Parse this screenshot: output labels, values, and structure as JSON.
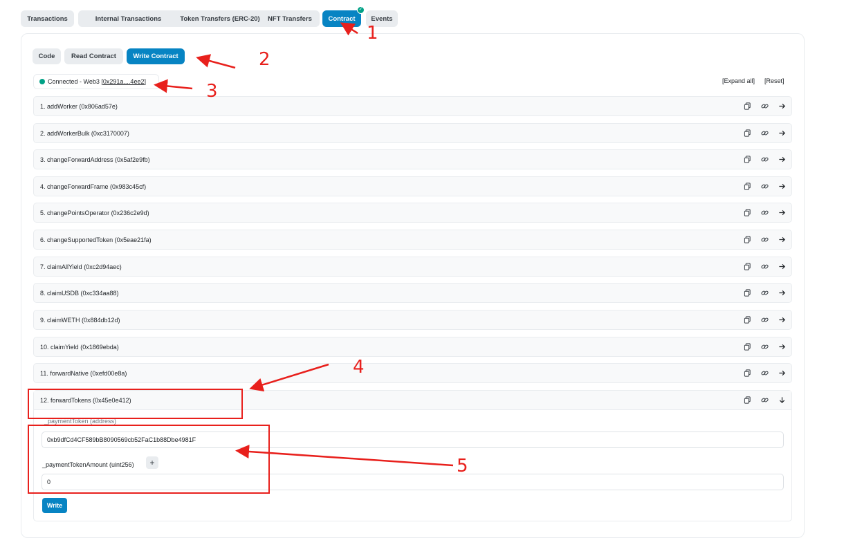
{
  "top_tabs": [
    "Transactions",
    "Internal Transactions",
    "Token Transfers (ERC-20)",
    "NFT Transfers",
    "Contract",
    "Events"
  ],
  "sub_tabs": [
    "Code",
    "Read Contract",
    "Write Contract"
  ],
  "connection": {
    "status": "Connected - Web3",
    "address": "0x291a....4ee2"
  },
  "controls": {
    "expand_all": "[Expand all]",
    "reset": "[Reset]"
  },
  "functions": [
    "1. addWorker (0x806ad57e)",
    "2. addWorkerBulk (0xc3170007)",
    "3. changeForwardAddress (0x5af2e9fb)",
    "4. changeForwardFrame (0x983c45cf)",
    "5. changePointsOperator (0x236c2e9d)",
    "6. changeSupportedToken (0x5eae21fa)",
    "7. claimAllYield (0xc2d94aec)",
    "8. claimUSDB (0xc334aa88)",
    "9. claimWETH (0x884db12d)",
    "10. claimYield (0x1869ebda)",
    "11. forwardNative (0xefd00e8a)"
  ],
  "expanded": {
    "title": "12. forwardTokens (0x45e0e412)",
    "param1_label": "_paymentToken (address)",
    "param1_value": "0xb9dfCd4CF589bB8090569cb52FaC1b88Dbe4981F",
    "param2_label": "_paymentTokenAmount (uint256)",
    "param2_value": "0",
    "plus": "+",
    "write_label": "Write"
  },
  "annotations": [
    "1",
    "2",
    "3",
    "4",
    "5"
  ],
  "colors": {
    "accent": "#0784c3",
    "success": "#00a186",
    "annotation": "#e8201c"
  },
  "icons": [
    "copy-icon",
    "link-icon",
    "arrow-right-icon",
    "arrow-down-icon",
    "check-icon"
  ]
}
